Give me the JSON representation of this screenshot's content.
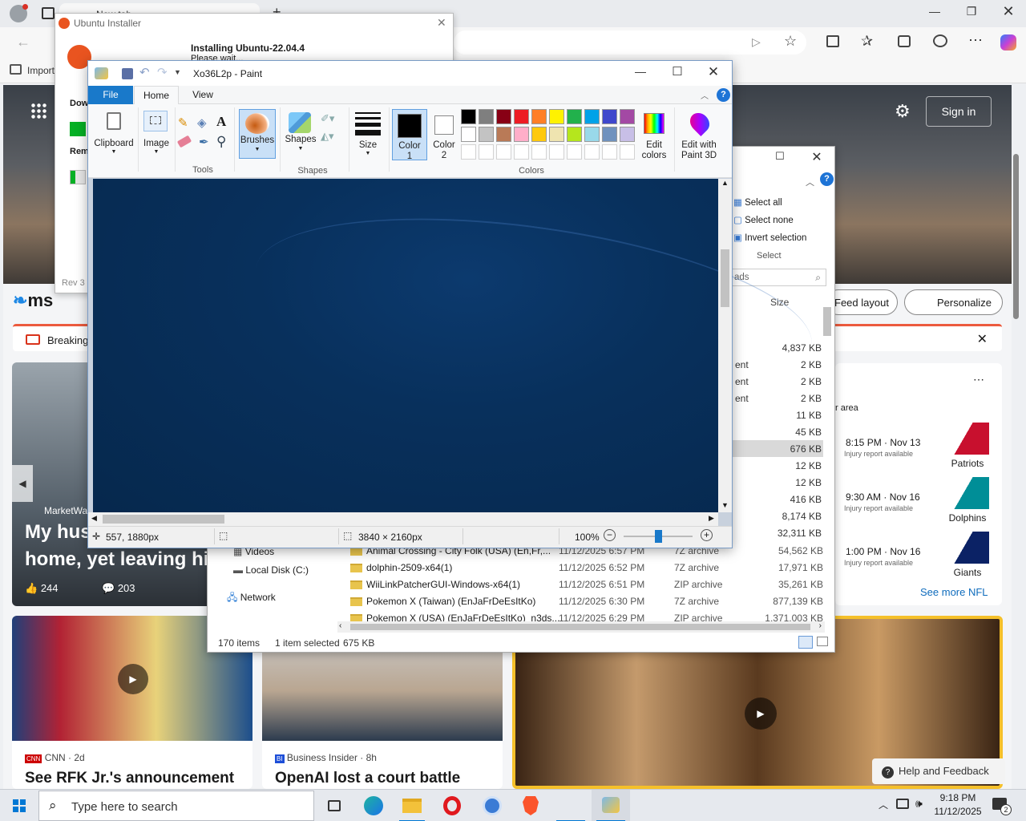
{
  "edge": {
    "tab_title": "New tab",
    "favorites_item": "Import",
    "sign_in": "Sign in",
    "feed_layout": "Feed layout",
    "personalize": "Personalize",
    "breaking_label": "Breaking",
    "msn_logo": "ms",
    "hero_source": "MarketWatch",
    "hero_title_line1": "My hus",
    "hero_title_line2": "home, yet leaving his",
    "hero_likes": "244",
    "hero_comments": "203",
    "card1": {
      "source": "CNN",
      "age": "2d",
      "title": "See RFK Jr.'s announcement"
    },
    "card2": {
      "source": "Business Insider",
      "age": "8h",
      "title": "OpenAI lost a court battle"
    },
    "nfl": {
      "area_label": "r area",
      "games": [
        {
          "time": "8:15 PM · Nov 13",
          "note": "Injury report available",
          "team": "Patriots",
          "color": "#c8102e"
        },
        {
          "time": "9:30 AM · Nov 16",
          "note": "Injury report available",
          "team": "Dolphins",
          "color": "#008e97"
        },
        {
          "time": "1:00 PM · Nov 16",
          "note": "Injury report available",
          "team": "Giants",
          "color": "#0b2265"
        }
      ],
      "see_more": "See more NFL"
    },
    "help_feedback": "Help and Feedback"
  },
  "ubuntu": {
    "title": "Ubuntu Installer",
    "heading": "Installing Ubuntu-22.04.4",
    "sub": "Please wait...",
    "download_label": "Dow",
    "remaining_label": "Rem",
    "rev_label": "Rev 3"
  },
  "explorer": {
    "select_all": "Select all",
    "select_none": "Select none",
    "invert_selection": "Invert selection",
    "select_group": "Select",
    "search_text": "ads",
    "col_size": "Size",
    "top_rows": [
      {
        "type": "",
        "size": "4,837 KB"
      },
      {
        "type": "ent",
        "size": "2 KB"
      },
      {
        "type": "ent",
        "size": "2 KB"
      },
      {
        "type": "ent",
        "size": "2 KB"
      },
      {
        "type": "",
        "size": "11 KB"
      },
      {
        "type": "",
        "size": "45 KB"
      },
      {
        "type": "",
        "size": "676 KB"
      },
      {
        "type": "",
        "size": "12 KB"
      },
      {
        "type": "",
        "size": "12 KB"
      },
      {
        "type": "",
        "size": "416 KB"
      },
      {
        "type": "",
        "size": "8,174 KB"
      },
      {
        "type": "",
        "size": "32,311 KB"
      }
    ],
    "rows": [
      {
        "name": "Animal Crossing - City Folk (USA) (En,Fr,...",
        "date": "11/12/2025 6:57 PM",
        "type": "7Z archive",
        "size": "54,562 KB"
      },
      {
        "name": "dolphin-2509-x64(1)",
        "date": "11/12/2025 6:52 PM",
        "type": "7Z archive",
        "size": "17,971 KB"
      },
      {
        "name": "WiiLinkPatcherGUI-Windows-x64(1)",
        "date": "11/12/2025 6:51 PM",
        "type": "ZIP archive",
        "size": "35,261 KB"
      },
      {
        "name": "Pokemon X (Taiwan) (EnJaFrDeEsItKo)",
        "date": "11/12/2025 6:30 PM",
        "type": "7Z archive",
        "size": "877,139 KB"
      },
      {
        "name": "Pokemon X (USA) (EnJaFrDeEsItKo)_n3ds...",
        "date": "11/12/2025 6:29 PM",
        "type": "ZIP archive",
        "size": "1,371,003 KB"
      }
    ],
    "nav": [
      "Videos",
      "Local Disk (C:)",
      "Network"
    ],
    "status_items": "170 items",
    "status_selected": "1 item selected",
    "status_size": "675 KB"
  },
  "paint": {
    "title": "Xo36L2p - Paint",
    "tab_file": "File",
    "tab_home": "Home",
    "tab_view": "View",
    "clipboard": "Clipboard",
    "image": "Image",
    "tools_group": "Tools",
    "brushes": "Brushes",
    "shapes": "Shapes",
    "shapes_group": "Shapes",
    "size": "Size",
    "color1_l1": "Color",
    "color1_l2": "1",
    "color2_l1": "Color",
    "color2_l2": "2",
    "edit_colors_l1": "Edit",
    "edit_colors_l2": "colors",
    "paint3d_l1": "Edit with",
    "paint3d_l2": "Paint 3D",
    "colors_group": "Colors",
    "palette_row1": [
      "#000000",
      "#7f7f7f",
      "#880015",
      "#ed1c24",
      "#ff7f27",
      "#fff200",
      "#22b14c",
      "#00a2e8",
      "#3f48cc",
      "#a349a4"
    ],
    "palette_row2": [
      "#ffffff",
      "#c3c3c3",
      "#b97a57",
      "#ffaec9",
      "#ffc90e",
      "#efe4b0",
      "#b5e61d",
      "#99d9ea",
      "#7092be",
      "#c8bfe7"
    ],
    "cursor_pos": "557, 1880px",
    "dimensions": "3840 × 2160px",
    "zoom": "100%",
    "zoom_fraction": 0.5
  },
  "taskbar": {
    "search_placeholder": "Type here to search",
    "time": "9:18 PM",
    "date": "11/12/2025",
    "notifications": "2"
  }
}
